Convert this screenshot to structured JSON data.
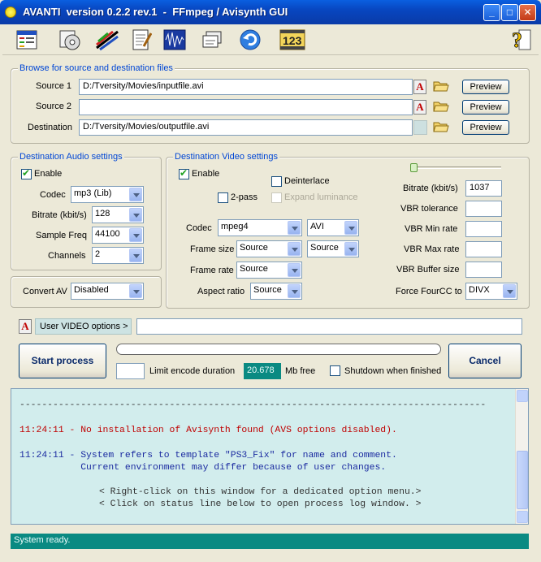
{
  "window": {
    "title": "AVANTI  version 0.2.2 rev.1  -  FFmpeg / Avisynth GUI"
  },
  "toolbar": {
    "icons": [
      "settings-window-icon",
      "media-info-icon",
      "audio-edit-icon",
      "notepad-icon",
      "waveform-icon",
      "batch-icon",
      "reset-icon",
      "counter-123-icon",
      "help-icon"
    ]
  },
  "browse": {
    "legend": "Browse for source and destination files",
    "source1_label": "Source 1",
    "source1_value": "D:/Tversity/Movies/inputfile.avi",
    "source2_label": "Source 2",
    "source2_value": "",
    "destination_label": "Destination",
    "destination_value": "D:/Tversity/Movies/outputfile.avi",
    "preview_label": "Preview"
  },
  "audio": {
    "legend": "Destination Audio settings",
    "enable_label": "Enable",
    "enabled": true,
    "codec_label": "Codec",
    "codec": "mp3 (Lib)",
    "bitrate_label": "Bitrate (kbit/s)",
    "bitrate": "128",
    "samplefreq_label": "Sample Freq",
    "samplefreq": "44100",
    "channels_label": "Channels",
    "channels": "2"
  },
  "convert": {
    "label": "Convert AV",
    "value": "Disabled"
  },
  "video": {
    "legend": "Destination Video settings",
    "enable_label": "Enable",
    "enabled": true,
    "deinterlace_label": "Deinterlace",
    "twopass_label": "2-pass",
    "expand_label": "Expand luminance",
    "codec_label": "Codec",
    "codec": "mpeg4",
    "container": "AVI",
    "framesize_label": "Frame size",
    "framesize_a": "Source",
    "framesize_b": "Source",
    "framerate_label": "Frame rate",
    "framerate": "Source",
    "aspect_label": "Aspect ratio",
    "aspect": "Source",
    "bitrate_label": "Bitrate (kbit/s)",
    "bitrate": "1037",
    "vbr_tol_label": "VBR tolerance",
    "vbr_min_label": "VBR Min rate",
    "vbr_max_label": "VBR Max rate",
    "vbr_buf_label": "VBR Buffer size",
    "fourcc_label": "Force FourCC to",
    "fourcc": "DIVX"
  },
  "user_options": {
    "label": "User VIDEO options >",
    "value": ""
  },
  "process": {
    "start_label": "Start process",
    "cancel_label": "Cancel",
    "limit_label": "Limit encode duration",
    "free_value": "20.678",
    "free_unit": "Mb free",
    "shutdown_label": "Shutdown when finished"
  },
  "log": {
    "separator": "------------------------------------------------------------------------------------",
    "lines": [
      "11:24:11 - No installation of Avisynth found (AVS options disabled).",
      "11:24:11 - System refers to template \"PS3_Fix\" for name and comment.",
      "           Current environment may differ because of user changes.",
      "< Right-click on this window for a dedicated option menu.>",
      "< Click on status line below to open process log window. >"
    ],
    "colors": {
      "error": "#c00000",
      "info": "#1a2aa0",
      "hint": "#333333"
    }
  },
  "status": {
    "text": "System ready."
  }
}
